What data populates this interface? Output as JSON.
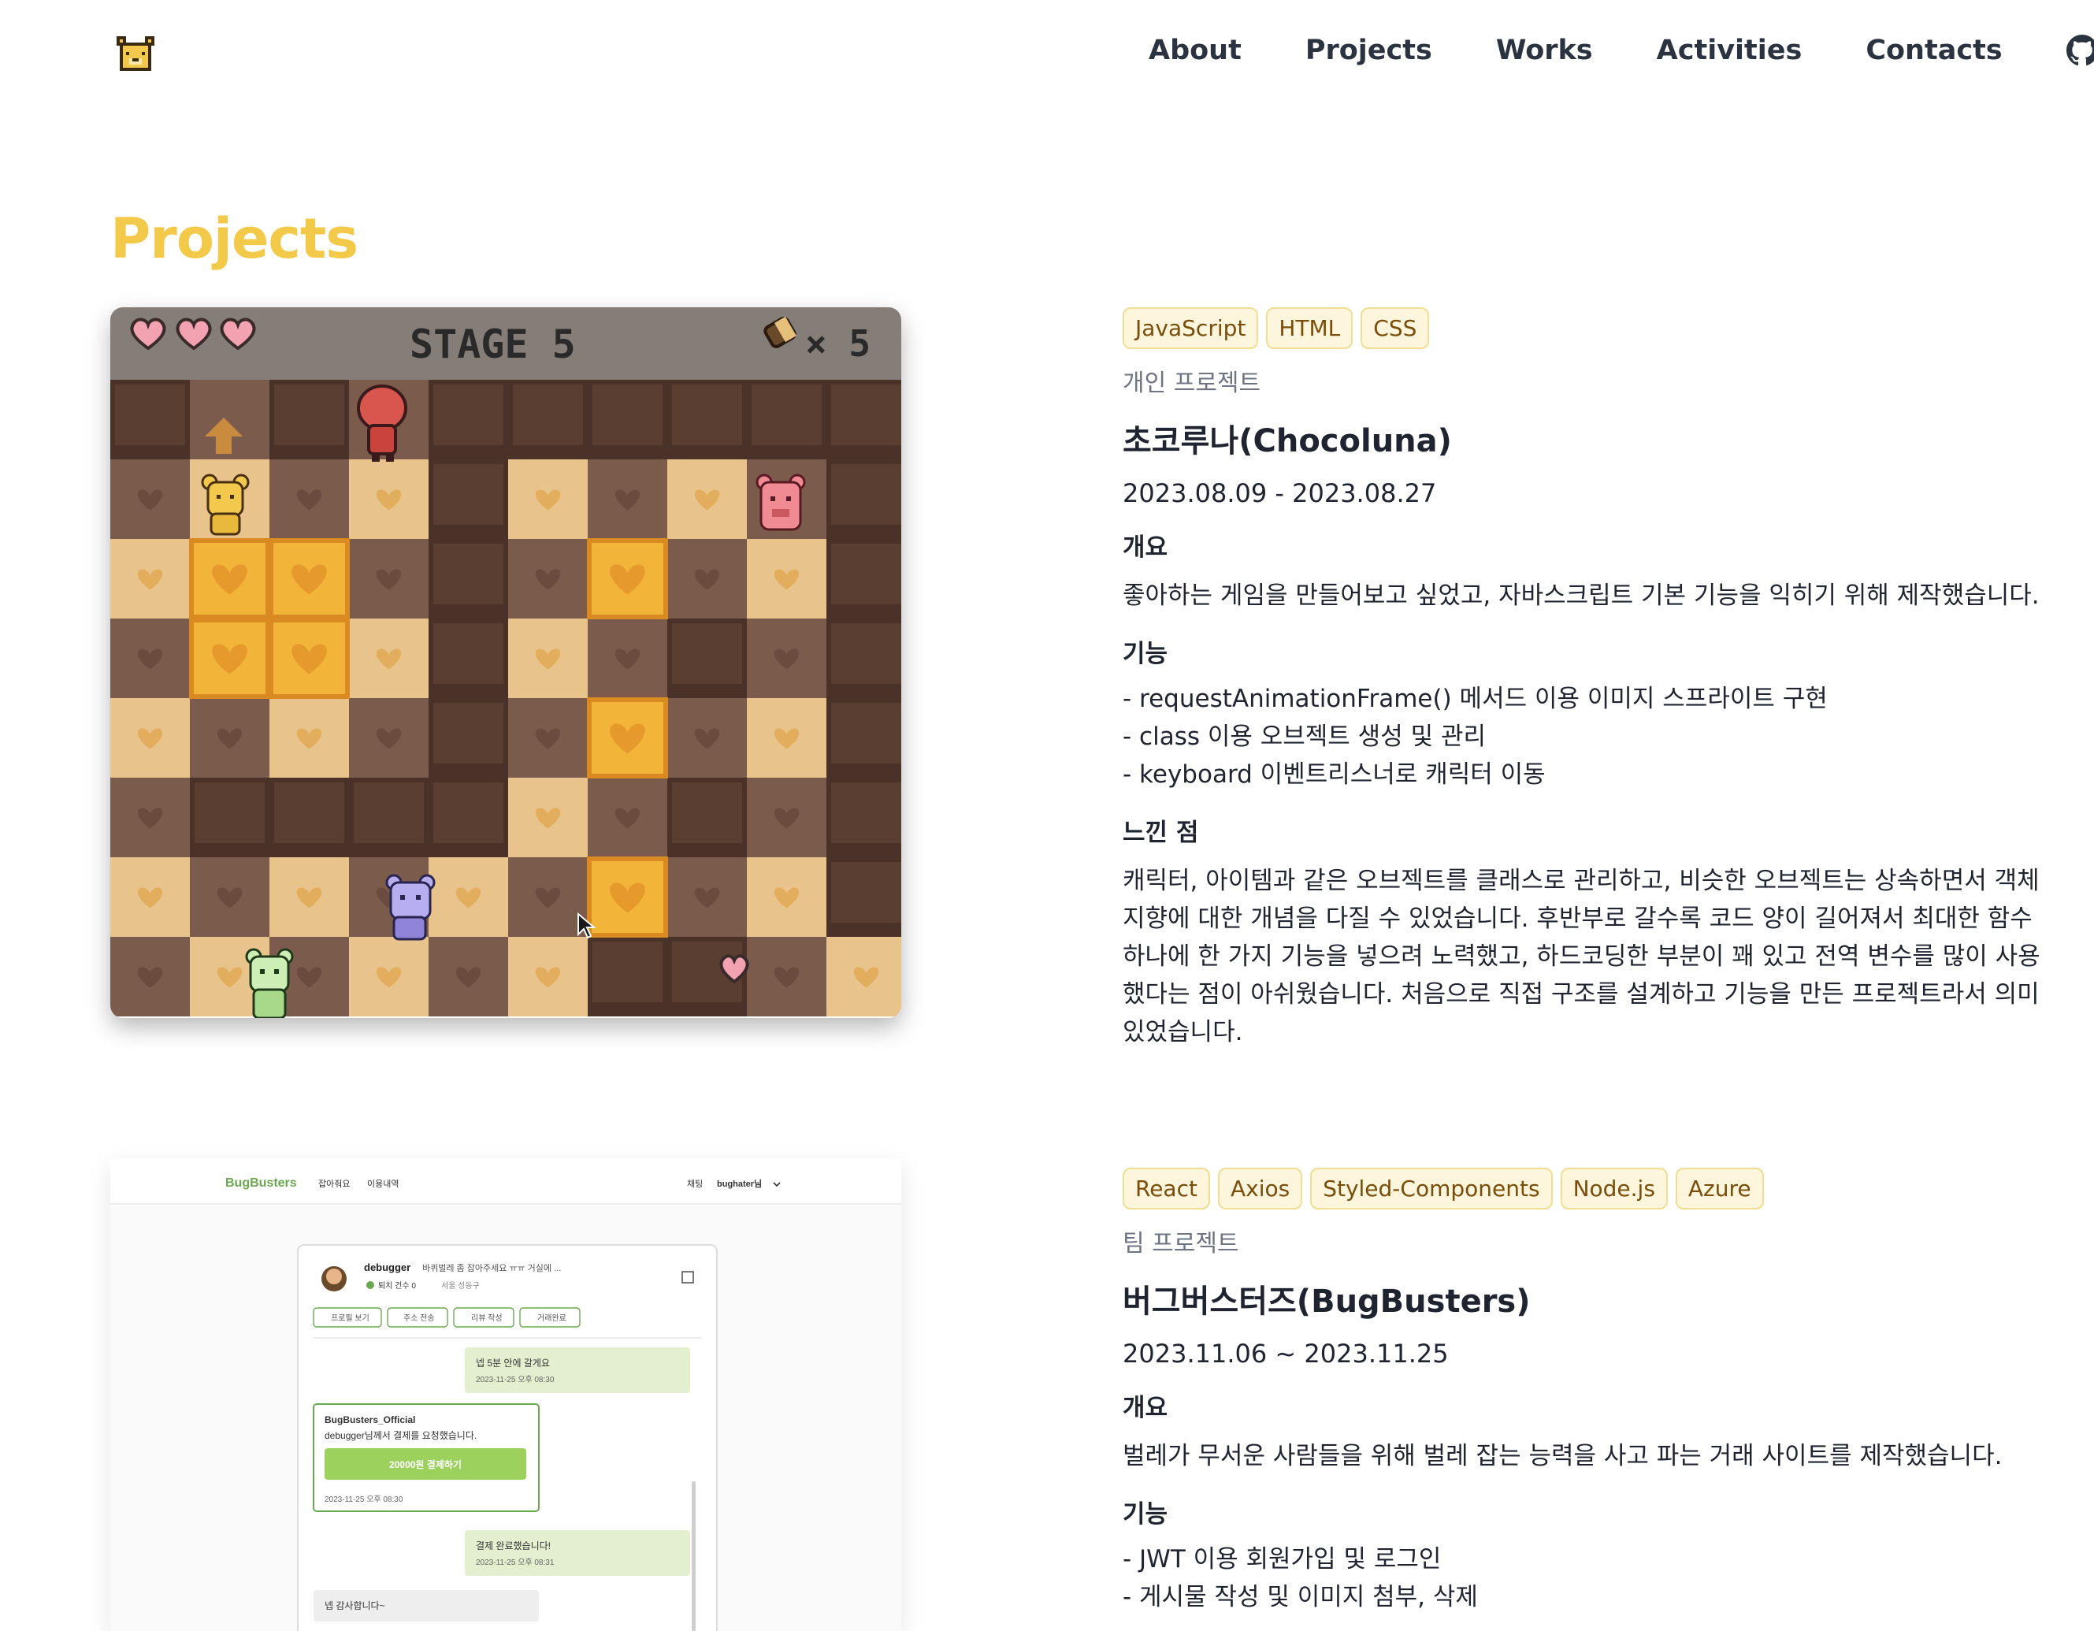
{
  "nav": {
    "items": [
      "About",
      "Projects",
      "Works",
      "Activities",
      "Contacts"
    ]
  },
  "page_title": "Projects",
  "projects": [
    {
      "tags": [
        "JavaScript",
        "HTML",
        "CSS"
      ],
      "kind": "개인 프로젝트",
      "title": "초코루나(Chocoluna)",
      "period": "2023.08.09 - 2023.08.27",
      "overview_label": "개요",
      "overview": "좋아하는 게임을 만들어보고 싶었고, 자바스크립트 기본 기능을 익히기 위해 제작했습니다.",
      "features_label": "기능",
      "features": [
        "- requestAnimationFrame() 메서드 이용 이미지 스프라이트 구현",
        "- class 이용 오브젝트 생성 및 관리",
        "- keyboard 이벤트리스너로 캐릭터 이동"
      ],
      "review_label": "느낀 점",
      "review": "캐릭터, 아이템과 같은 오브젝트를 클래스로 관리하고, 비슷한 오브젝트는 상속하면서 객체 지향에 대한 개념을 다질 수 있었습니다. 후반부로 갈수록 코드 양이 길어져서 최대한 함수 하나에 한 가지 기능을 넣으려 노력했고, 하드코딩한 부분이 꽤 있고 전역 변수를 많이 사용했다는 점이 아쉬웠습니다. 처음으로 직접 구조를 설계하고 기능을 만든 프로젝트라서 의미있었습니다.",
      "screenshot": {
        "stage_label": "STAGE 5",
        "item_count": "× 5",
        "hearts": 3
      }
    },
    {
      "tags": [
        "React",
        "Axios",
        "Styled-Components",
        "Node.js",
        "Azure"
      ],
      "kind": "팀 프로젝트",
      "title": "버그버스터즈(BugBusters)",
      "period": "2023.11.06 ~ 2023.11.25",
      "overview_label": "개요",
      "overview": "벌레가 무서운 사람들을 위해 벌레 잡는 능력을 사고 파는 거래 사이트를 제작했습니다.",
      "features_label": "기능",
      "features": [
        "- JWT 이용 회원가입 및 로그인",
        "- 게시물 작성 및 이미지 첨부, 삭제"
      ],
      "screenshot": {
        "brand": "BugBusters",
        "nav1": "잡아줘요",
        "nav2": "이용내역",
        "chat_label": "채팅",
        "user": "bughater님",
        "chat_user": "debugger",
        "chat_user_desc": "바퀴벌레 좀 잡아주세요 ㅠㅠ 거실에 ...",
        "catch_count": "퇴치 건수 0",
        "location": "서울 성동구",
        "actions": [
          "프로필 보기",
          "주소 전송",
          "리뷰 작성",
          "거래완료"
        ],
        "msg1": "넵 5분 안에 갈게요",
        "msg1_time": "2023-11-25 오후 08:30",
        "official": "BugBusters_Official",
        "official_msg": "debugger님께서 결제를 요청했습니다.",
        "pay_button": "20000원 결제하기",
        "official_time": "2023-11-25 오후 08:30",
        "msg2": "결제 완료했습니다!",
        "msg2_time": "2023-11-25 오후 08:31",
        "msg3": "넵 감사합니다~"
      }
    }
  ]
}
